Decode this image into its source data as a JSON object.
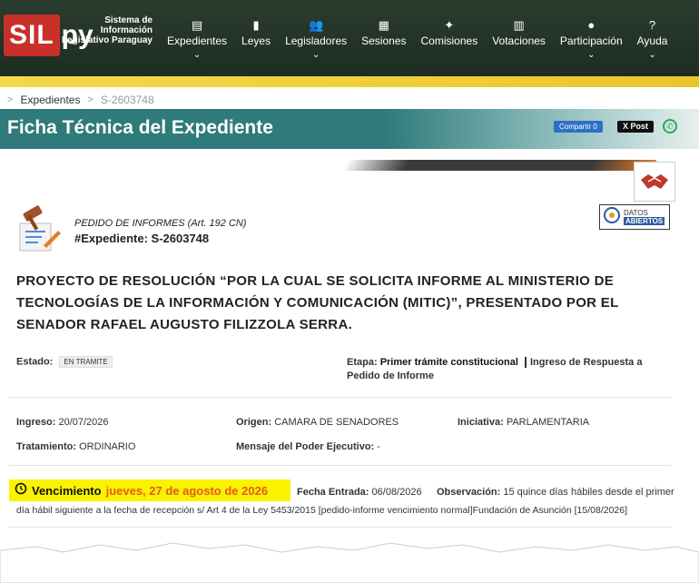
{
  "header": {
    "logo_main": "SIL",
    "logo_suffix": "py",
    "logo_text": "Sistema de Información Legislativo Paraguay",
    "nav": [
      {
        "label": "Expedientes",
        "icon": "document-icon",
        "glyph": "▤",
        "chevron": true
      },
      {
        "label": "Leyes",
        "icon": "book-icon",
        "glyph": "▮",
        "chevron": false
      },
      {
        "label": "Legisladores",
        "icon": "people-icon",
        "glyph": "👥",
        "chevron": true
      },
      {
        "label": "Sesiones",
        "icon": "calendar-icon",
        "glyph": "▦",
        "chevron": false
      },
      {
        "label": "Comisiones",
        "icon": "group-icon",
        "glyph": "✦",
        "chevron": false
      },
      {
        "label": "Votaciones",
        "icon": "vote-icon",
        "glyph": "▥",
        "chevron": false
      },
      {
        "label": "Participación",
        "icon": "chat-icon",
        "glyph": "●",
        "chevron": true
      },
      {
        "label": "Ayuda",
        "icon": "help-icon",
        "glyph": "?",
        "chevron": true
      }
    ]
  },
  "breadcrumb": {
    "home_sep": ">",
    "section": "Expedientes",
    "current": "S-2603748"
  },
  "page_title": "Ficha Técnica del Expediente",
  "share": {
    "facebook": "Compartir 0",
    "x": "X Post"
  },
  "record": {
    "type": "PEDIDO DE INFORMES (Art. 192 CN)",
    "id": "#Expediente: S-2603748",
    "datos_1": "DATOS",
    "datos_2": "ABIERTOS",
    "title": "PROYECTO DE RESOLUCIÓN “POR LA CUAL SE SOLICITA INFORME AL MINISTERIO DE TECNOLOGÍAS DE LA INFORMACIÓN Y COMUNICACIÓN (MITIC)”, PRESENTADO POR EL SENADOR RAFAEL AUGUSTO FILIZZOLA SERRA."
  },
  "details": {
    "estado_label": "Estado:",
    "estado_value": "EN TRAMITE",
    "etapa_label": "Etapa:",
    "etapa_value": "Primer trámite constitucional",
    "etapa_extra": "Ingreso de Respuesta a Pedido de Informe",
    "ingreso_label": "Ingreso:",
    "ingreso_value": "20/07/2026",
    "origen_label": "Origen:",
    "origen_value": "CAMARA DE SENADORES",
    "iniciativa_label": "Iniciativa:",
    "iniciativa_value": "PARLAMENTARIA",
    "tratamiento_label": "Tratamiento:",
    "tratamiento_value": "ORDINARIO",
    "mensaje_label": "Mensaje del Poder Ejecutivo:",
    "mensaje_value": "-",
    "vencimiento_label": "Vencimiento",
    "vencimiento_value": "jueves, 27 de agosto de 2026",
    "fecha_entrada_label": "Fecha Entrada:",
    "fecha_entrada_value": "06/08/2026",
    "observacion_label": "Observación:",
    "observacion_value": "15 quince días hábiles desde el primer",
    "observacion_cont": "día hábil siguiente a la fecha de recepción s/ Art 4 de la Ley 5453/2015 [pedido-informe vencimiento normal]Fundación de Asunción [15/08/2026]"
  },
  "colors": {
    "nav_bg": "#1d2c21",
    "title_band": "#2f7a7a",
    "highlight": "#fbf200",
    "date_orange": "#e35b1a"
  }
}
